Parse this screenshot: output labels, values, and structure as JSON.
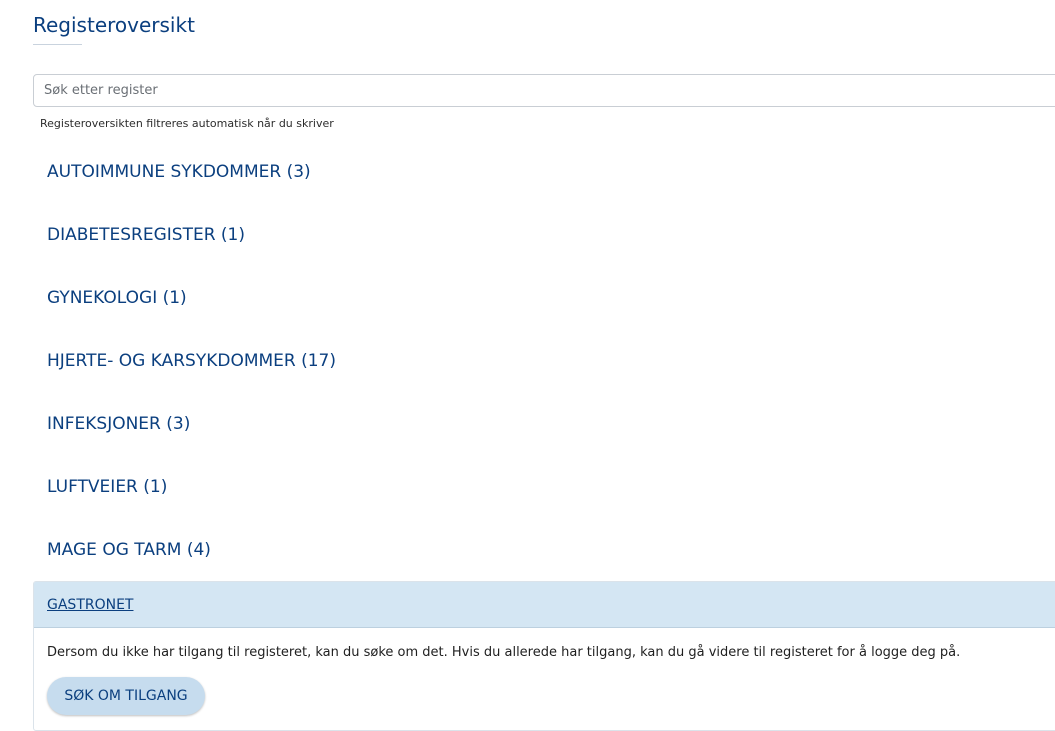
{
  "page": {
    "title": "Registeroversikt"
  },
  "search": {
    "placeholder": "Søk etter register",
    "value": "",
    "hint": "Registeroversikten filtreres automatisk når du skriver"
  },
  "categories": [
    {
      "label": "AUTOIMMUNE SYKDOMMER (3)"
    },
    {
      "label": "DIABETESREGISTER (1)"
    },
    {
      "label": "GYNEKOLOGI (1)"
    },
    {
      "label": "HJERTE- OG KARSYKDOMMER (17)"
    },
    {
      "label": "INFEKSJONER (3)"
    },
    {
      "label": "LUFTVEIER (1)"
    },
    {
      "label": "MAGE OG TARM (4)"
    }
  ],
  "expanded_register": {
    "name": "GASTRONET",
    "description": "Dersom du ikke har tilgang til registeret, kan du søke om det. Hvis du allerede har tilgang, kan du gå videre til registeret for å logge deg på.",
    "button_label": "SØK OM TILGANG"
  },
  "colors": {
    "primary_text": "#0b3f7f",
    "panel_header_bg": "#d4e6f3",
    "button_bg": "#c6dcee"
  }
}
